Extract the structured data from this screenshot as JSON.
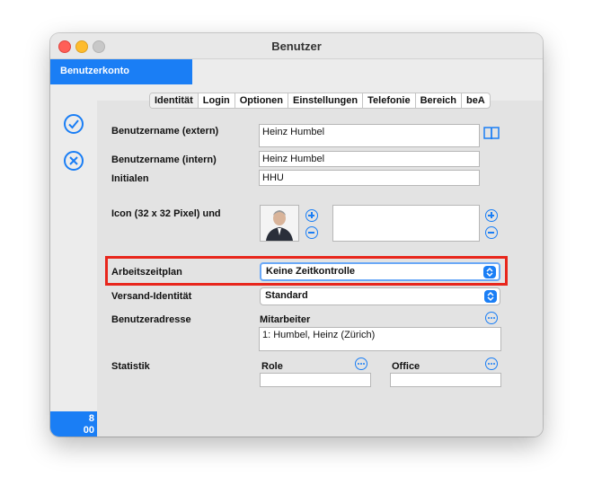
{
  "window": {
    "title": "Benutzer"
  },
  "sidebar": {
    "active_tab": "Benutzerkonto",
    "badge_line1": "8",
    "badge_line2": "00"
  },
  "tabs": [
    "Identität",
    "Login",
    "Optionen",
    "Einstellungen",
    "Telefonie",
    "Bereich",
    "beA"
  ],
  "form": {
    "username_extern": {
      "label": "Benutzername (extern)",
      "value": "Heinz Humbel"
    },
    "username_intern": {
      "label": "Benutzername (intern)",
      "value": "Heinz Humbel"
    },
    "initials": {
      "label": "Initialen",
      "value": "HHU"
    },
    "icon": {
      "label": "Icon (32 x 32 Pixel) und"
    },
    "worktime": {
      "label": "Arbeitszeitplan",
      "value": "Keine Zeitkontrolle"
    },
    "send_identity": {
      "label": "Versand-Identität",
      "value": "Standard"
    },
    "user_address": {
      "label": "Benutzeradresse",
      "sub_label": "Mitarbeiter",
      "value": "1: Humbel, Heinz (Zürich)"
    },
    "statistics": {
      "label": "Statistik",
      "role_label": "Role",
      "office_label": "Office"
    }
  },
  "colors": {
    "accent": "#1a7ef5",
    "highlight": "#e8261c"
  }
}
